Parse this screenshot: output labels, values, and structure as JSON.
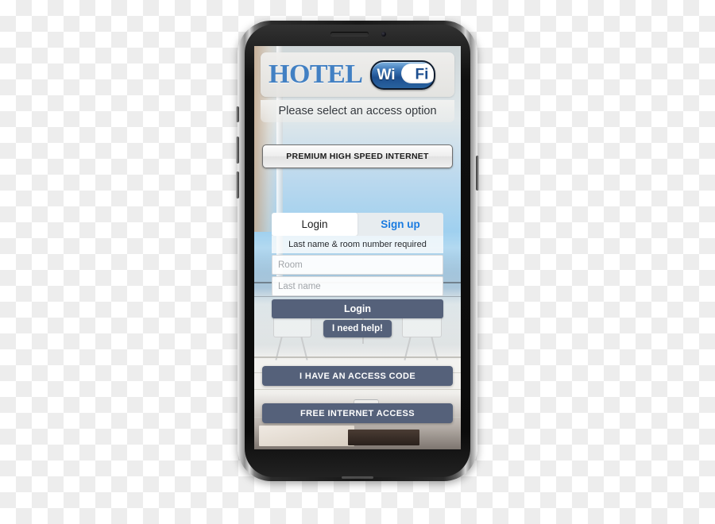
{
  "device": {
    "name": "smartphone-mockup",
    "earpiece": "earpiece-speaker",
    "camera": "front-camera",
    "buttons": [
      "mute-switch",
      "volume-up",
      "volume-down",
      "power"
    ]
  },
  "screen": {
    "background_description": "seaside terrace photo with white table, chairs, glass and books"
  },
  "header": {
    "brand": "HOTEL",
    "wifi_logo": {
      "left_text": "Wi",
      "right_text": "Fi"
    },
    "prompt": "Please select an access option"
  },
  "options": {
    "premium_label": "PREMIUM HIGH SPEED INTERNET",
    "access_code_label": "I HAVE AN ACCESS CODE",
    "free_access_label": "FREE INTERNET ACCESS"
  },
  "login_card": {
    "tabs": [
      {
        "label": "Login",
        "active": true
      },
      {
        "label": "Sign up",
        "active": false
      }
    ],
    "hint": "Last name & room number required",
    "fields": [
      {
        "name": "room",
        "value": "",
        "placeholder": "Room"
      },
      {
        "name": "last-name",
        "value": "",
        "placeholder": "Last name"
      }
    ],
    "submit_label": "Login",
    "help_label": "I need help!"
  },
  "colors": {
    "brand_blue": "#4280c3",
    "link_blue": "#1a7be0",
    "button_slate": "#55617a",
    "wifi_dark_blue": "#1d4f90",
    "text_dark": "#1c1c1c"
  }
}
